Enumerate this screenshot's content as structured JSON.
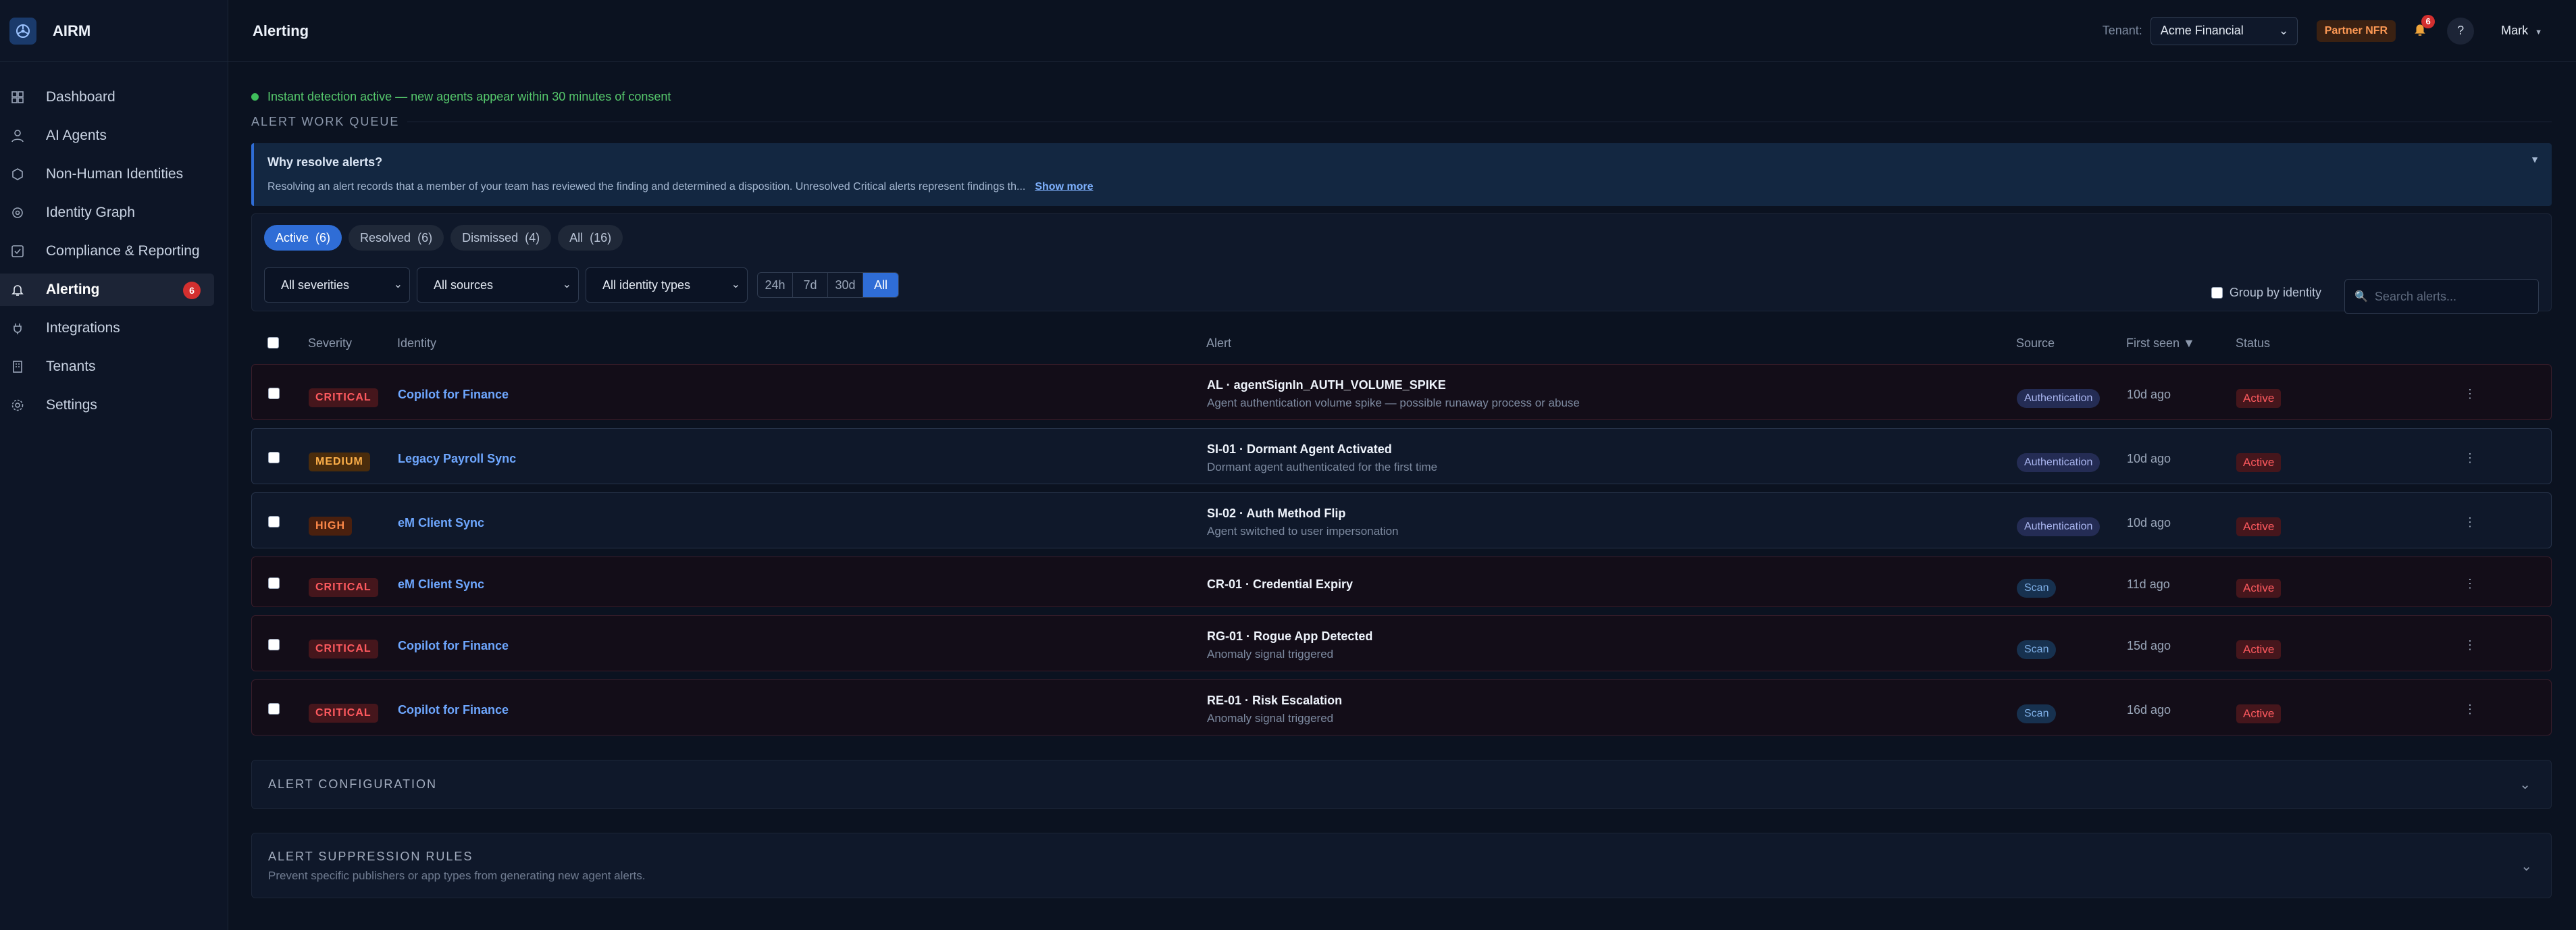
{
  "app": {
    "name": "AIRM"
  },
  "sidebar": {
    "items": [
      {
        "label": "Dashboard",
        "icon": "grid-icon"
      },
      {
        "label": "AI Agents",
        "icon": "person-icon"
      },
      {
        "label": "Non-Human Identities",
        "icon": "hexagon-icon"
      },
      {
        "label": "Identity Graph",
        "icon": "graph-icon"
      },
      {
        "label": "Compliance & Reporting",
        "icon": "checklist-icon"
      },
      {
        "label": "Alerting",
        "icon": "bell-icon",
        "badge": "6"
      },
      {
        "label": "Integrations",
        "icon": "plug-icon"
      },
      {
        "label": "Tenants",
        "icon": "building-icon"
      },
      {
        "label": "Settings",
        "icon": "gear-icon"
      }
    ]
  },
  "header": {
    "title": "Alerting",
    "tenant_label": "Tenant:",
    "tenant_value": "Acme Financial",
    "partner_badge": "Partner NFR",
    "notif_count": "6",
    "help": "?",
    "user": "Mark"
  },
  "detection": {
    "text": "Instant detection active — new agents appear within 30 minutes of consent"
  },
  "queue": {
    "label": "ALERT WORK QUEUE"
  },
  "why": {
    "title": "Why resolve alerts?",
    "text": "Resolving an alert records that a member of your team has reviewed the finding and determined a disposition. Unresolved Critical alerts represent findings th...",
    "show_more": "Show more"
  },
  "tabs": [
    {
      "label": "Active",
      "count": "(6)"
    },
    {
      "label": "Resolved",
      "count": "(6)"
    },
    {
      "label": "Dismissed",
      "count": "(4)"
    },
    {
      "label": "All",
      "count": "(16)"
    }
  ],
  "filters": {
    "severity": "All severities",
    "sources": "All sources",
    "identity_types": "All identity types",
    "ranges": [
      "24h",
      "7d",
      "30d",
      "All"
    ],
    "group_by": "Group by identity",
    "search_placeholder": "Search alerts..."
  },
  "table": {
    "headers": {
      "severity": "Severity",
      "identity": "Identity",
      "alert": "Alert",
      "source": "Source",
      "first_seen": "First seen ▼",
      "status": "Status"
    },
    "rows": [
      {
        "severity": "CRITICAL",
        "identity": "Copilot for Finance",
        "alert_title": "AL · agentSignIn_AUTH_VOLUME_SPIKE",
        "alert_sub": "Agent authentication volume spike — possible runaway process or abuse",
        "source": "Authentication",
        "first_seen": "10d ago",
        "status": "Active",
        "menu": "⋮"
      },
      {
        "severity": "MEDIUM",
        "identity": "Legacy Payroll Sync",
        "alert_title": "SI-01 · Dormant Agent Activated",
        "alert_sub": "Dormant agent authenticated for the first time",
        "source": "Authentication",
        "first_seen": "10d ago",
        "status": "Active",
        "menu": "⋮"
      },
      {
        "severity": "HIGH",
        "identity": "eM Client Sync",
        "alert_title": "SI-02 · Auth Method Flip",
        "alert_sub": "Agent switched to user impersonation",
        "source": "Authentication",
        "first_seen": "10d ago",
        "status": "Active",
        "menu": "⋮"
      },
      {
        "severity": "CRITICAL",
        "identity": "eM Client Sync",
        "alert_title": "CR-01 · Credential Expiry",
        "alert_sub": "",
        "source": "Scan",
        "first_seen": "11d ago",
        "status": "Active",
        "menu": "⋮"
      },
      {
        "severity": "CRITICAL",
        "identity": "Copilot for Finance",
        "alert_title": "RG-01 · Rogue App Detected",
        "alert_sub": "Anomaly signal triggered",
        "source": "Scan",
        "first_seen": "15d ago",
        "status": "Active",
        "menu": "⋮"
      },
      {
        "severity": "CRITICAL",
        "identity": "Copilot for Finance",
        "alert_title": "RE-01 · Risk Escalation",
        "alert_sub": "Anomaly signal triggered",
        "source": "Scan",
        "first_seen": "16d ago",
        "status": "Active",
        "menu": "⋮"
      }
    ]
  },
  "config": {
    "label": "ALERT CONFIGURATION"
  },
  "suppression": {
    "label": "ALERT SUPPRESSION RULES",
    "sub": "Prevent specific publishers or app types from generating new agent alerts."
  },
  "colors": {
    "accent": "#2f6dd6",
    "critical": "#ff5a5f",
    "medium": "#ffb14a",
    "high": "#ff8a4a",
    "success": "#56c96c"
  }
}
